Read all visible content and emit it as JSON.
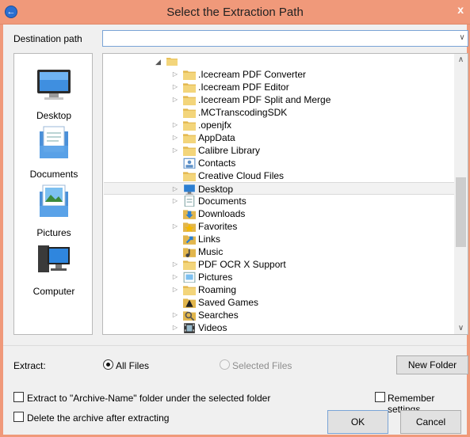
{
  "window": {
    "title": "Select the Extraction Path",
    "app_icon": "back-arrow-icon",
    "close_glyph": "x",
    "accent": "#f0997a"
  },
  "destination": {
    "label": "Destination path",
    "value": ""
  },
  "places": [
    {
      "label": "Desktop",
      "icon": "desktop-monitor-icon"
    },
    {
      "label": "Documents",
      "icon": "documents-icon"
    },
    {
      "label": "Pictures",
      "icon": "pictures-icon"
    },
    {
      "label": "Computer",
      "icon": "computer-icon"
    }
  ],
  "tree": {
    "items": [
      {
        "label": ".Icecream PDF Converter",
        "icon": "folder-icon",
        "expandable": true
      },
      {
        "label": ".Icecream PDF Editor",
        "icon": "folder-icon",
        "expandable": true
      },
      {
        "label": ".Icecream PDF Split and Merge",
        "icon": "folder-icon",
        "expandable": true
      },
      {
        "label": ".MCTranscodingSDK",
        "icon": "folder-icon",
        "expandable": false
      },
      {
        "label": ".openjfx",
        "icon": "folder-icon",
        "expandable": true
      },
      {
        "label": "AppData",
        "icon": "folder-icon",
        "expandable": true
      },
      {
        "label": "Calibre Library",
        "icon": "folder-icon",
        "expandable": true
      },
      {
        "label": "Contacts",
        "icon": "contacts-folder-icon",
        "expandable": false
      },
      {
        "label": "Creative Cloud Files",
        "icon": "folder-icon",
        "expandable": false
      },
      {
        "label": "Desktop",
        "icon": "desktop-folder-icon",
        "expandable": true,
        "selected": true
      },
      {
        "label": "Documents",
        "icon": "documents-folder-icon",
        "expandable": true
      },
      {
        "label": "Downloads",
        "icon": "downloads-folder-icon",
        "expandable": false
      },
      {
        "label": "Favorites",
        "icon": "favorites-folder-icon",
        "expandable": true
      },
      {
        "label": "Links",
        "icon": "links-folder-icon",
        "expandable": false
      },
      {
        "label": "Music",
        "icon": "music-folder-icon",
        "expandable": false
      },
      {
        "label": "PDF OCR X Support",
        "icon": "folder-icon",
        "expandable": true
      },
      {
        "label": "Pictures",
        "icon": "pictures-folder-icon",
        "expandable": true
      },
      {
        "label": "Roaming",
        "icon": "folder-icon",
        "expandable": true
      },
      {
        "label": "Saved Games",
        "icon": "saved-games-folder-icon",
        "expandable": false
      },
      {
        "label": "Searches",
        "icon": "searches-folder-icon",
        "expandable": true
      },
      {
        "label": "Videos",
        "icon": "videos-folder-icon",
        "expandable": true
      }
    ]
  },
  "extract": {
    "label": "Extract:",
    "all_files": "All Files",
    "selected_files": "Selected Files",
    "selected_option": "All Files"
  },
  "buttons": {
    "new_folder": "New Folder",
    "ok": "OK",
    "cancel": "Cancel"
  },
  "options": {
    "extract_to_archive_folder": "Extract to \"Archive-Name\" folder under the selected folder",
    "remember_settings": "Remember settings",
    "delete_archive": "Delete the archive after extracting",
    "extract_to_archive_folder_checked": false,
    "remember_settings_checked": false,
    "delete_archive_checked": false
  }
}
